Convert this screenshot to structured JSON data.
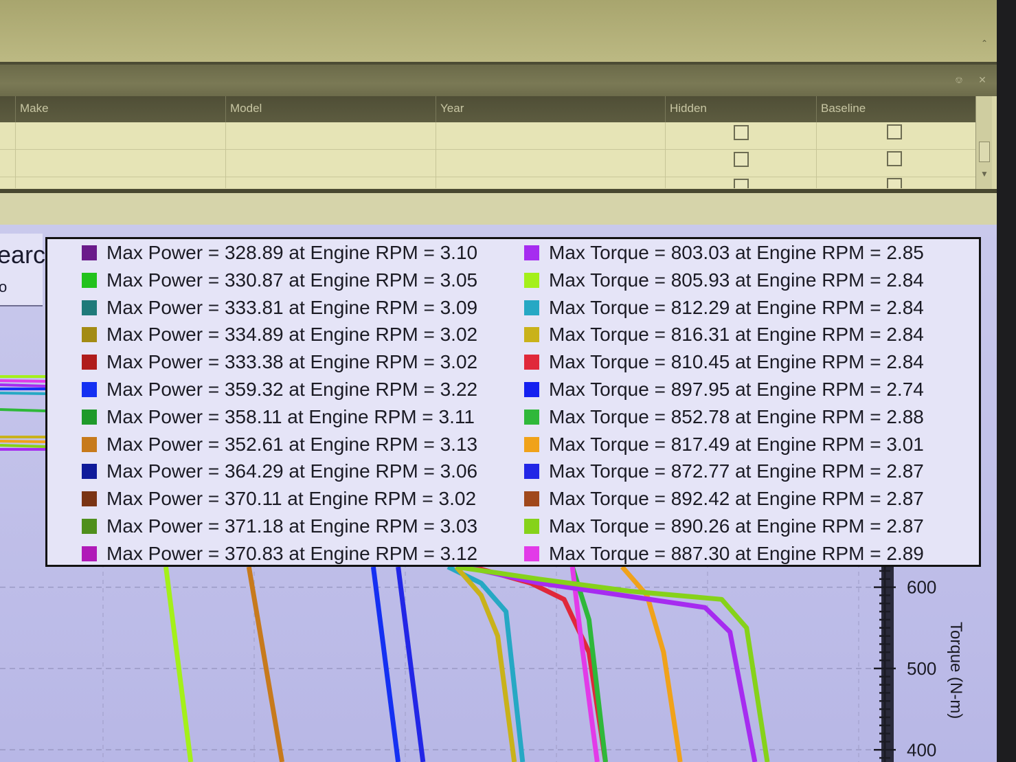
{
  "grid": {
    "columns": [
      "Make",
      "Model",
      "Year",
      "Hidden",
      "Baseline"
    ]
  },
  "search_partial": "earc",
  "search_sub": "o",
  "colors": {
    "chart_bg": "#c2c1ea",
    "legend_bg": "#e5e4f7"
  },
  "legend": {
    "power": [
      {
        "text": "Max Power = 328.89 at Engine RPM = 3.10",
        "color": "#6a1b8a"
      },
      {
        "text": "Max Power = 330.87 at Engine RPM = 3.05",
        "color": "#22c21c"
      },
      {
        "text": "Max Power = 333.81 at Engine RPM = 3.09",
        "color": "#1f7a7a"
      },
      {
        "text": "Max Power = 334.89 at Engine RPM = 3.02",
        "color": "#a38b14"
      },
      {
        "text": "Max Power = 333.38 at Engine RPM = 3.02",
        "color": "#b01c1c"
      },
      {
        "text": "Max Power = 359.32 at Engine RPM = 3.22",
        "color": "#1430f2"
      },
      {
        "text": "Max Power = 358.11 at Engine RPM = 3.11",
        "color": "#1f9a2a"
      },
      {
        "text": "Max Power = 352.61 at Engine RPM = 3.13",
        "color": "#c77a1c"
      },
      {
        "text": "Max Power = 364.29 at Engine RPM = 3.06",
        "color": "#0f1a9a"
      },
      {
        "text": "Max Power = 370.11 at Engine RPM = 3.02",
        "color": "#7a3414"
      },
      {
        "text": "Max Power = 371.18 at Engine RPM = 3.03",
        "color": "#4f8f1c"
      },
      {
        "text": "Max Power = 370.83 at Engine RPM = 3.12",
        "color": "#b01ab8"
      }
    ],
    "torque": [
      {
        "text": "Max Torque = 803.03 at Engine RPM = 2.85",
        "color": "#a62cf0"
      },
      {
        "text": "Max Torque = 805.93 at Engine RPM = 2.84",
        "color": "#a4f01a"
      },
      {
        "text": "Max Torque = 812.29 at Engine RPM = 2.84",
        "color": "#26a8c4"
      },
      {
        "text": "Max Torque = 816.31 at Engine RPM = 2.84",
        "color": "#c9b21a"
      },
      {
        "text": "Max Torque = 810.45 at Engine RPM = 2.84",
        "color": "#e0283a"
      },
      {
        "text": "Max Torque = 897.95 at Engine RPM = 2.74",
        "color": "#1420f0"
      },
      {
        "text": "Max Torque = 852.78 at Engine RPM = 2.88",
        "color": "#2fb83a"
      },
      {
        "text": "Max Torque = 817.49 at Engine RPM = 3.01",
        "color": "#f0a21a"
      },
      {
        "text": "Max Torque = 872.77 at Engine RPM = 2.87",
        "color": "#2226e6"
      },
      {
        "text": "Max Torque = 892.42 at Engine RPM = 2.87",
        "color": "#a0481c"
      },
      {
        "text": "Max Torque = 890.26 at Engine RPM = 2.87",
        "color": "#86d21a"
      },
      {
        "text": "Max Torque = 887.30 at Engine RPM = 2.89",
        "color": "#e23ae8"
      }
    ]
  },
  "chart_data": {
    "type": "line",
    "title": "",
    "xlabel": "",
    "ylabel": "Torque (N-m)",
    "y_ticks": [
      400,
      500,
      600
    ],
    "ylim": [
      385,
      625
    ],
    "grid": true,
    "series": [
      {
        "color": "#a4f01a",
        "x": [
          2.1,
          2.16
        ],
        "y": [
          625,
          385
        ]
      },
      {
        "color": "#c77a1c",
        "x": [
          2.3,
          2.38
        ],
        "y": [
          625,
          385
        ]
      },
      {
        "color": "#1430f2",
        "x": [
          2.6,
          2.66
        ],
        "y": [
          625,
          385
        ]
      },
      {
        "color": "#2226e6",
        "x": [
          2.66,
          2.72
        ],
        "y": [
          625,
          385
        ]
      },
      {
        "color": "#26a8c4",
        "x": [
          2.78,
          2.86,
          2.92,
          2.96
        ],
        "y": [
          625,
          605,
          570,
          385
        ]
      },
      {
        "color": "#c9b21a",
        "x": [
          2.8,
          2.86,
          2.9,
          2.94
        ],
        "y": [
          625,
          590,
          540,
          385
        ]
      },
      {
        "color": "#e0283a",
        "x": [
          2.84,
          2.98,
          3.06,
          3.12,
          3.16
        ],
        "y": [
          625,
          605,
          585,
          520,
          385
        ]
      },
      {
        "color": "#2fb83a",
        "x": [
          3.08,
          3.12,
          3.16
        ],
        "y": [
          625,
          560,
          385
        ]
      },
      {
        "color": "#e23ae8",
        "x": [
          3.08,
          3.1,
          3.14
        ],
        "y": [
          625,
          540,
          385
        ]
      },
      {
        "color": "#f0a21a",
        "x": [
          3.2,
          3.26,
          3.3,
          3.34
        ],
        "y": [
          625,
          590,
          520,
          385
        ]
      },
      {
        "color": "#a62cf0",
        "x": [
          2.82,
          3.0,
          3.2,
          3.4,
          3.46,
          3.52
        ],
        "y": [
          625,
          605,
          590,
          575,
          545,
          385
        ]
      },
      {
        "color": "#86d21a",
        "x": [
          2.8,
          3.0,
          3.22,
          3.44,
          3.5,
          3.55
        ],
        "y": [
          625,
          610,
          595,
          585,
          550,
          385
        ]
      }
    ],
    "xlim": [
      1.7,
      3.82
    ]
  }
}
